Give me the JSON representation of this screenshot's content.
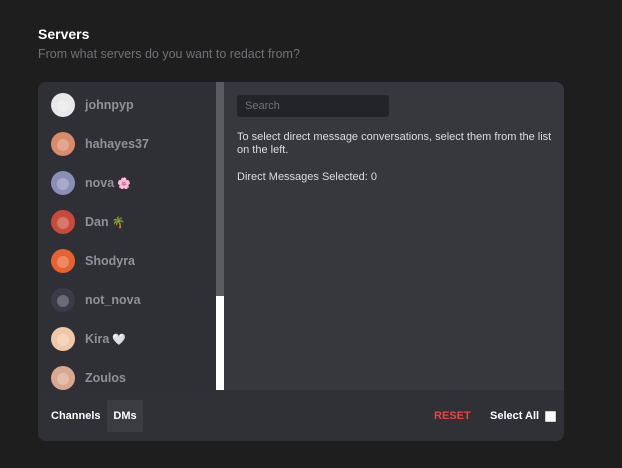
{
  "section": {
    "title": "Servers",
    "subtitle": "From what servers do you want to redact from?"
  },
  "dm_list": [
    {
      "name": "johnpyp",
      "emoji": "",
      "avatar_color": "#e8e8e8",
      "avatar_icon": "face-avatar-icon"
    },
    {
      "name": "hahayes37",
      "emoji": "",
      "avatar_color": "#d98a6a",
      "avatar_icon": "photo-avatar-icon"
    },
    {
      "name": "nova",
      "emoji": "🌸",
      "avatar_color": "#8a8fb8",
      "avatar_icon": "anime-avatar-icon"
    },
    {
      "name": "Dan",
      "emoji": "🌴",
      "avatar_color": "#c84a3a",
      "avatar_icon": "cartoon-avatar-icon"
    },
    {
      "name": "Shodyra",
      "emoji": "",
      "avatar_color": "#e8622e",
      "avatar_icon": "person-avatar-icon"
    },
    {
      "name": "not_nova",
      "emoji": "",
      "avatar_color": "#3a3a48",
      "avatar_icon": "anime-avatar-icon"
    },
    {
      "name": "Kira",
      "emoji": "🤍",
      "avatar_color": "#f0c8a8",
      "avatar_icon": "anime-avatar-icon"
    },
    {
      "name": "Zoulos",
      "emoji": "",
      "avatar_color": "#d8a890",
      "avatar_icon": "photo-avatar-icon"
    }
  ],
  "search": {
    "placeholder": "Search"
  },
  "info_text": "To select direct message conversations, select them from the list on the left.",
  "selected_text": "Direct Messages Selected: 0",
  "footer": {
    "tabs": [
      "Channels",
      "DMs"
    ],
    "active_tab": "DMs",
    "reset_label": "RESET",
    "select_all_label": "Select All",
    "select_all_checked": false
  },
  "colors": {
    "background": "#1e1e1f",
    "panel": "#36383e",
    "sidebar": "#2e3035",
    "reset": "#ed4245"
  }
}
